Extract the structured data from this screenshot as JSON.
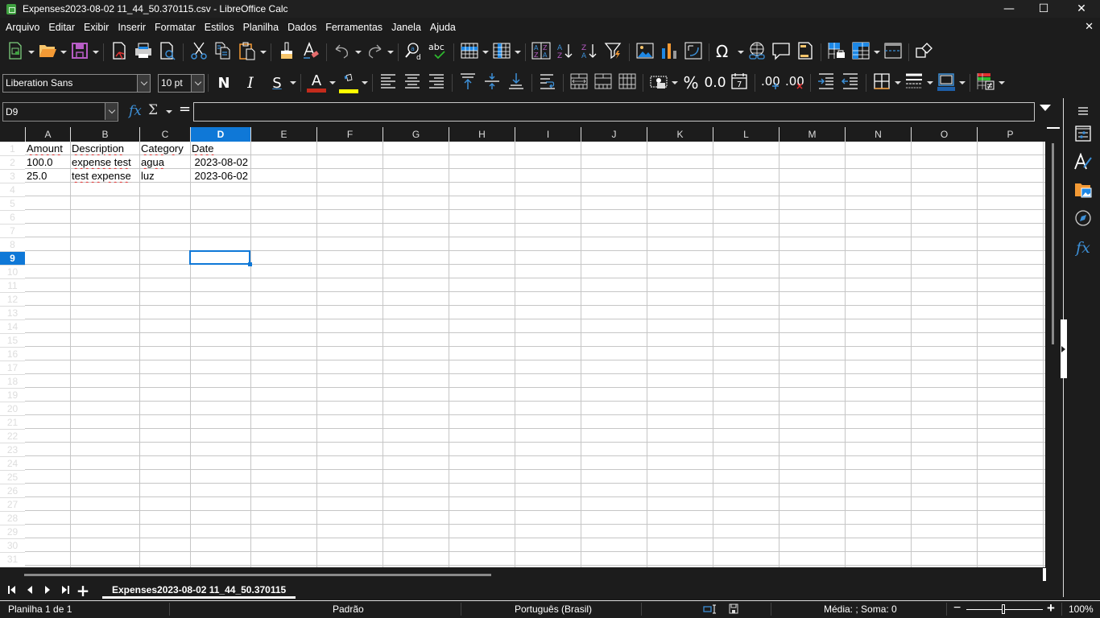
{
  "window": {
    "title": "Expenses2023-08-02 11_44_50.370115.csv - LibreOffice Calc",
    "minimize": "—",
    "maximize": "☐",
    "close": "✕"
  },
  "menubar": {
    "items": [
      "Arquivo",
      "Editar",
      "Exibir",
      "Inserir",
      "Formatar",
      "Estilos",
      "Planilha",
      "Dados",
      "Ferramentas",
      "Janela",
      "Ajuda"
    ],
    "close_doc": "✕"
  },
  "toolbar_standard": {
    "icons": [
      "new-spreadsheet-icon",
      "open-folder-icon",
      "save-icon",
      "export-pdf-icon",
      "print-icon",
      "print-preview-icon",
      "cut-icon",
      "copy-icon",
      "paste-icon",
      "clone-formatting-icon",
      "clear-formatting-icon",
      "undo-icon",
      "redo-icon",
      "find-replace-icon",
      "spellcheck-icon",
      "row-icon",
      "column-icon",
      "sort-icon",
      "sort-ascending-icon",
      "sort-descending-icon",
      "autofilter-icon",
      "insert-image-icon",
      "insert-chart-icon",
      "pivot-table-icon",
      "special-character-icon",
      "hyperlink-icon",
      "comment-icon",
      "header-footer-icon",
      "define-print-area-icon",
      "freeze-rows-columns-icon",
      "split-window-icon",
      "show-draw-functions-icon"
    ],
    "spellcheck_text": "abc"
  },
  "toolbar_formatting": {
    "font_name": "Liberation Sans",
    "font_size": "10 pt",
    "bold_label": "N",
    "italic_label": "I",
    "underline_label": "S",
    "font_color_label": "A",
    "font_color": "#c42b1c",
    "highlight_color": "#ffff00",
    "percent_label": "%",
    "number_format_label": "0.0",
    "add_decimal_label": ".00",
    "delete_decimal_label": ".00",
    "date_label": "7"
  },
  "formula_bar": {
    "name_box": "D9",
    "fx_label": "fx",
    "sigma_label": "Σ",
    "equals_label": "=",
    "formula_value": ""
  },
  "sheet": {
    "columns": [
      "A",
      "B",
      "C",
      "D",
      "E",
      "F",
      "G",
      "H",
      "I",
      "J",
      "K",
      "L",
      "M",
      "N",
      "O",
      "P"
    ],
    "selected_column": "D",
    "rows": [
      "1",
      "2",
      "3",
      "4",
      "5",
      "6",
      "7",
      "8",
      "9",
      "10",
      "11",
      "12",
      "13",
      "14",
      "15",
      "16",
      "17",
      "18",
      "19",
      "20",
      "21",
      "22",
      "23",
      "24",
      "25",
      "26",
      "27",
      "28",
      "29",
      "30",
      "31"
    ],
    "selected_row": "9",
    "headers": [
      "Amount",
      "Description",
      "Category",
      "Date"
    ],
    "data": [
      [
        "100.0",
        "expense test",
        "agua",
        "2023-08-02"
      ],
      [
        "25.0",
        "test expense",
        "luz",
        "2023-06-02"
      ]
    ],
    "active_cell": "D9"
  },
  "sheet_tabs": {
    "tabs": [
      "Expenses2023-08-02 11_44_50.370115"
    ],
    "add_label": "+"
  },
  "sidebar": {
    "items": [
      "sidebar-menu",
      "properties",
      "styles",
      "gallery",
      "navigator",
      "functions"
    ]
  },
  "statusbar": {
    "sheet_info": "Planilha 1 de 1",
    "page_style": "Padrão",
    "language": "Português (Brasil)",
    "summary": "Média: ; Soma: 0",
    "zoom_minus": "−",
    "zoom_plus": "+",
    "zoom_level": "100%",
    "zoom_fraction": 0.5
  }
}
